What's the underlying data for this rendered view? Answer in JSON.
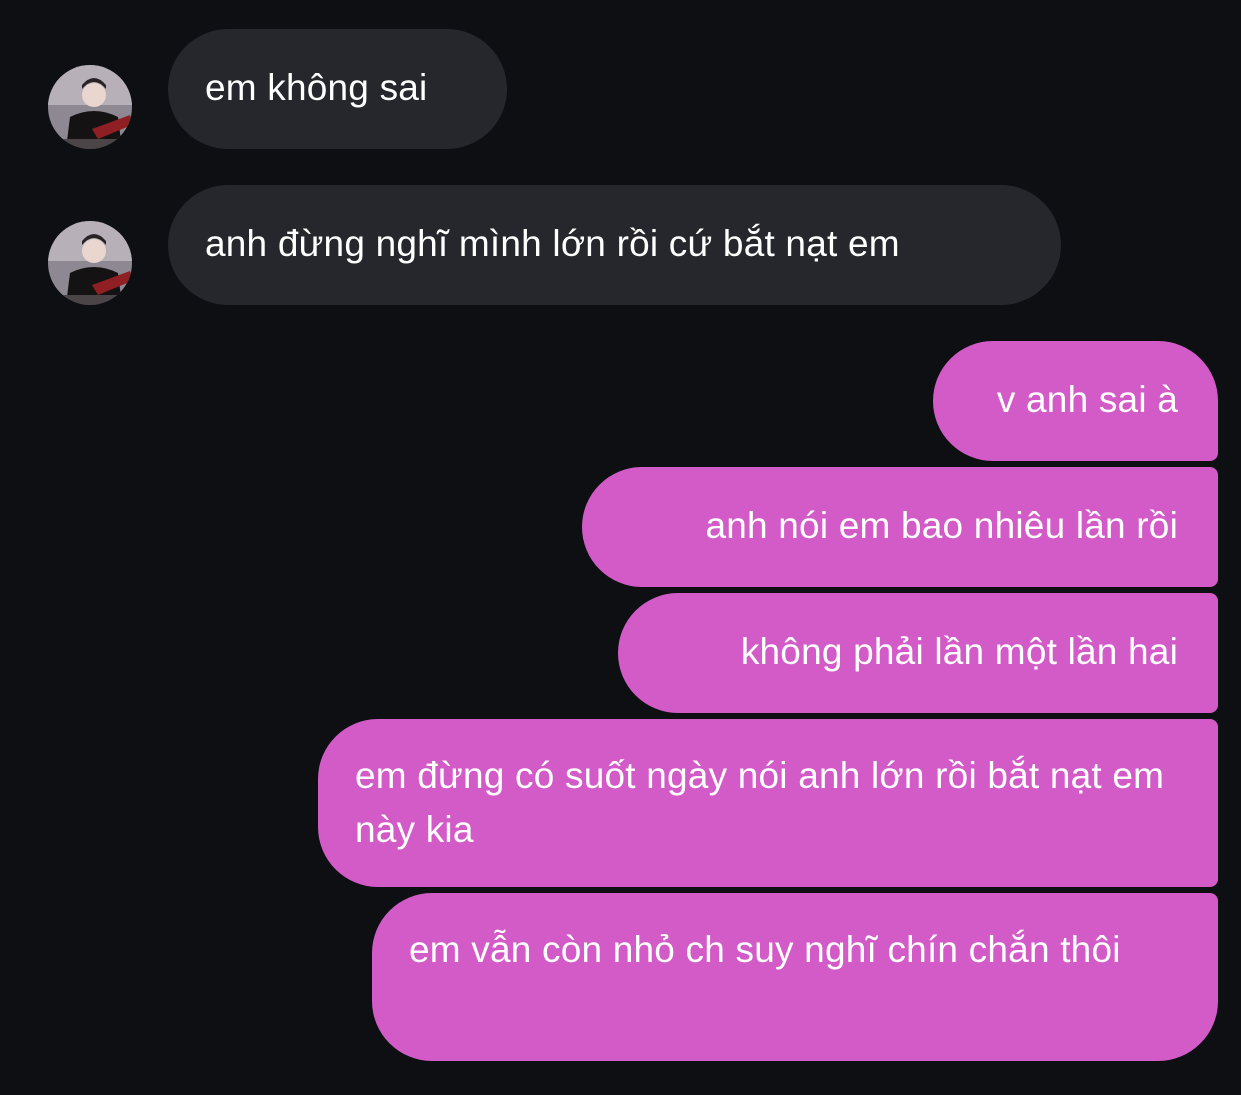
{
  "messages": {
    "incoming": [
      {
        "text": "em không sai"
      },
      {
        "text": "anh đừng nghĩ mình lớn rồi cứ bắt nạt em"
      }
    ],
    "outgoing": [
      {
        "text": "v anh sai à"
      },
      {
        "text": "anh nói em bao nhiêu lần rồi"
      },
      {
        "text": "không phải lần một lần hai"
      },
      {
        "text": "em đừng có suốt ngày nói anh lớn rồi bắt nạt em này kia"
      },
      {
        "text": "em vẫn còn nhỏ ch suy nghĩ chín chắn thôi"
      }
    ]
  },
  "colors": {
    "background": "#0d0f13",
    "incoming_bubble": "#25272c",
    "outgoing_bubble": "#d35bc8",
    "text": "#ffffff"
  },
  "icons": {
    "avatar": "contact-avatar-photo"
  }
}
